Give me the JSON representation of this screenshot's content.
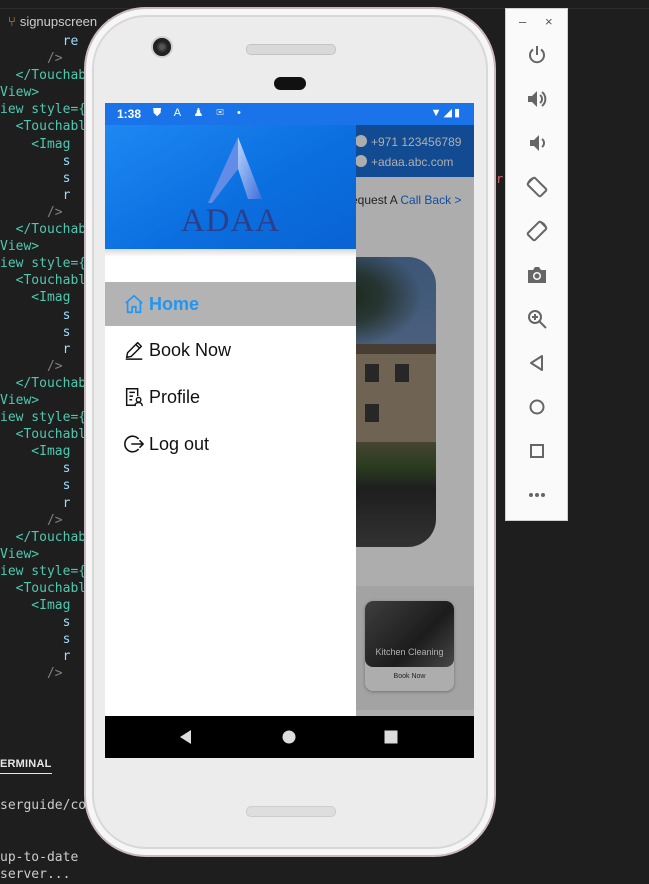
{
  "editor": {
    "tab_label": "signupscreen",
    "tab_close": "×",
    "code_lines": [
      "        re",
      "      />",
      "  </Touchabl",
      "View>",
      "iew style={",
      "  <Touchabl",
      "    <Imag",
      "        s",
      "        s",
      "        r",
      "      />",
      "  </Touchabl",
      "View>",
      "iew style={",
      "  <Touchabl",
      "    <Imag",
      "        s",
      "        s",
      "        r",
      "      />",
      "  </Touchabl",
      "View>",
      "iew style={",
      "  <Touchabl",
      "    <Imag",
      "        s",
      "        s",
      "        r",
      "      />",
      "  </Touchabl",
      "View>",
      "iew style={",
      "  <Touchabl",
      "    <Imag",
      "        s",
      "        s",
      "        r",
      "      />"
    ],
    "terminal_tab": "ERMINAL",
    "terminal_lines": [
      "serguide/comm",
      "up-to-date",
      "server..."
    ],
    "warn_glyph": "r"
  },
  "status_bar": {
    "time": "1:38",
    "left_icons": "⛊ A ♟ ✉ •",
    "right_icons": "▼◢▮"
  },
  "app": {
    "phone": "+971 123456789",
    "email": "+adaa.abc.com",
    "callback_prefix": "equest A",
    "callback_link": "Call Back >",
    "service_label": "Kitchen Cleaning",
    "service_button": "Book Now"
  },
  "drawer": {
    "logo_text": "ADAA",
    "items": [
      {
        "label": "Home",
        "icon": "home-icon"
      },
      {
        "label": "Book Now",
        "icon": "pencil-icon"
      },
      {
        "label": "Profile",
        "icon": "profile-icon"
      },
      {
        "label": "Log out",
        "icon": "logout-icon"
      }
    ],
    "active_color": "#2196f3"
  },
  "emulator_toolbar": {
    "minimize": "–",
    "close": "×",
    "buttons": [
      "power-icon",
      "volume-up-icon",
      "volume-down-icon",
      "rotate-left-icon",
      "rotate-right-icon",
      "camera-icon",
      "zoom-icon",
      "back-icon",
      "home-circle-icon",
      "overview-icon",
      "more-icon"
    ]
  },
  "colors": {
    "status_bar": "#1a73e8",
    "drawer_header": "#0b6fe0",
    "active_item_bg": "#b3b3b3"
  }
}
